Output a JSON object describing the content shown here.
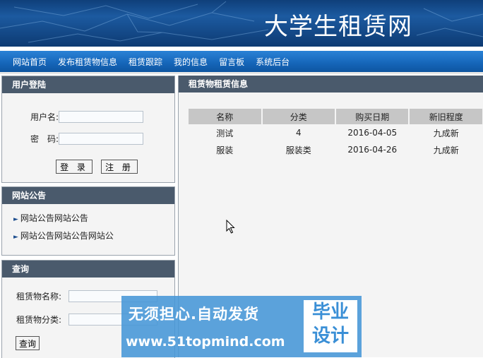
{
  "site": {
    "title": "大学生租赁网"
  },
  "nav": {
    "items": [
      "网站首页",
      "发布租赁物信息",
      "租赁跟踪",
      "我的信息",
      "留言板",
      "系统后台"
    ]
  },
  "login": {
    "title": "用户登陆",
    "username_label": "用户名:",
    "password_label": "密　码:",
    "login_button": "登 录",
    "register_button": "注 册"
  },
  "notice": {
    "title": "网站公告",
    "items": [
      "网站公告网站公告",
      "网站公告网站公告网站公"
    ]
  },
  "query": {
    "title": "查询",
    "name_label": "租赁物名称:",
    "type_label": "租赁物分类:",
    "submit": "查询"
  },
  "main": {
    "title": "租赁物租赁信息",
    "columns": [
      "名称",
      "分类",
      "购买日期",
      "新旧程度"
    ],
    "rows": [
      [
        "测试",
        "4",
        "2016-04-05",
        "九成新"
      ],
      [
        "服装",
        "服装类",
        "2016-04-26",
        "九成新"
      ]
    ]
  },
  "watermark": {
    "line1": "无须担心.自动发货",
    "line2": "www.51topmind.com",
    "badge1": "毕业",
    "badge2": "设计"
  }
}
